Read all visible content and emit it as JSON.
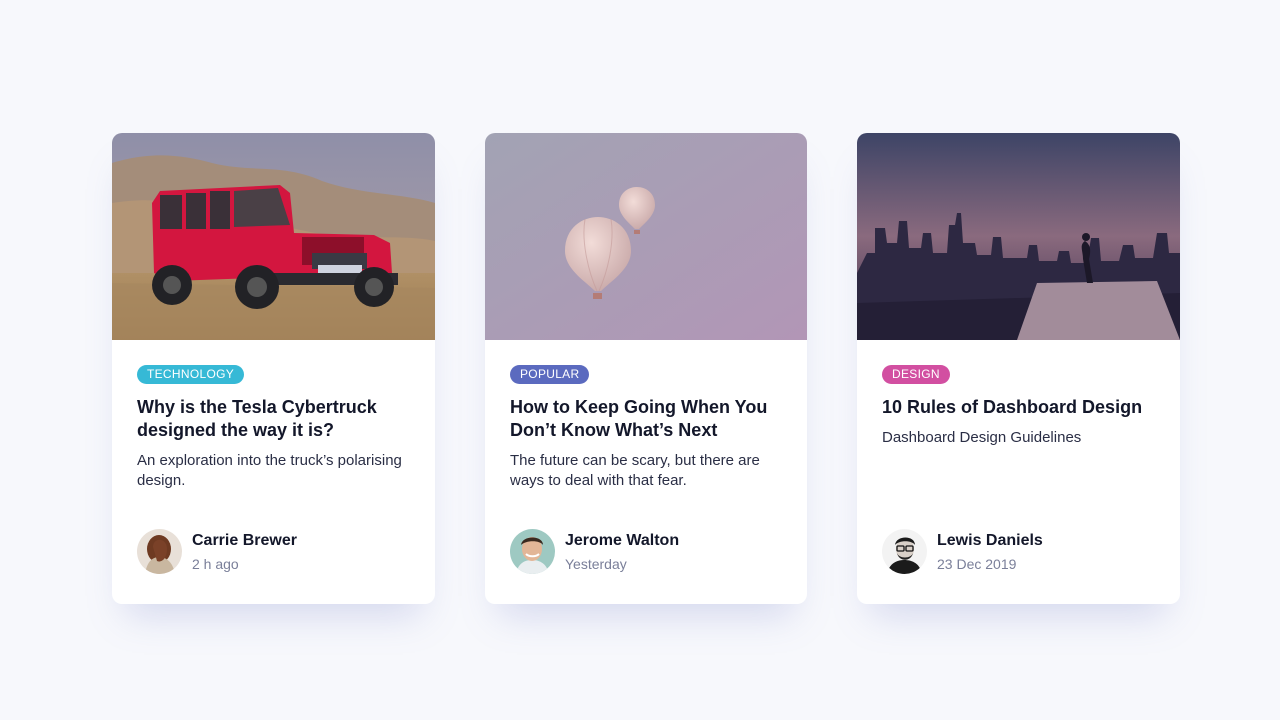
{
  "cards": [
    {
      "tag": "TECHNOLOGY",
      "tag_color": "#36b9d6",
      "title": "Why is the Tesla Cybertruck designed the way it is?",
      "description": "An exploration into the truck’s polarising design.",
      "author": "Carrie Brewer",
      "time": "2 h ago",
      "image_icon": "red-jeep-photo"
    },
    {
      "tag": "POPULAR",
      "tag_color": "#5b6abf",
      "title": "How to Keep Going When You Don’t Know What’s Next",
      "description": "The future can be scary, but there are ways to deal with that fear.",
      "author": "Jerome Walton",
      "time": "Yesterday",
      "image_icon": "hot-air-balloons-photo"
    },
    {
      "tag": "DESIGN",
      "tag_color": "#d24fa1",
      "title": "10 Rules of Dashboard Design",
      "description": "Dashboard Design Guidelines",
      "author": "Lewis Daniels",
      "time": "23 Dec 2019",
      "image_icon": "city-skyline-photo"
    }
  ]
}
